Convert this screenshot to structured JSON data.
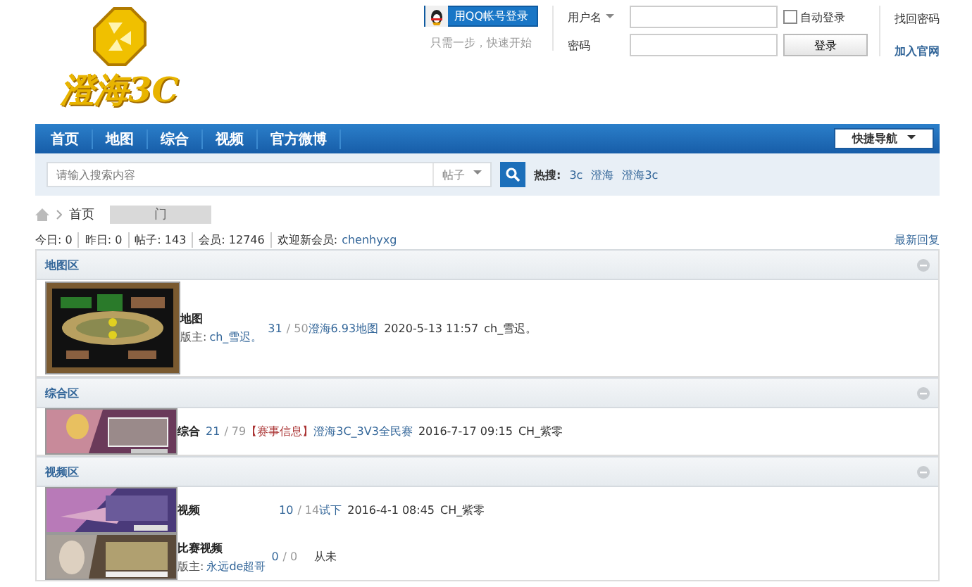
{
  "logo": {
    "text": "澄海3C"
  },
  "login": {
    "qq_button": "用QQ帐号登录",
    "qq_hint": "只需一步，快速开始",
    "username_label": "用户名",
    "password_label": "密码",
    "remember": {
      "label": "自动登录",
      "checked": false
    },
    "submit": "登录",
    "forgot": "找回密码",
    "register": "加入官网"
  },
  "nav": {
    "items": [
      {
        "label": "首页",
        "selected": false
      },
      {
        "label": "地图",
        "selected": false
      },
      {
        "label": "综合",
        "selected": false
      },
      {
        "label": "视频",
        "selected": false
      },
      {
        "label": "官方微博",
        "selected": false
      }
    ],
    "quick": "快捷导航"
  },
  "search": {
    "placeholder": "请输入搜索内容",
    "type": "帖子",
    "hot_label": "热搜:",
    "hot": [
      "3c",
      "澄海",
      "澄海3c"
    ]
  },
  "breadcrumb": {
    "home": "首页",
    "current": "门"
  },
  "stats": {
    "items": [
      "今日: 0",
      "昨日: 0",
      "帖子: 143",
      "会员: 12746"
    ],
    "welcome": "欢迎新会员:",
    "new_member": "chenhyxg",
    "latest": "最新回复"
  },
  "sections": [
    {
      "title": "地图区",
      "forums": [
        {
          "name": "地图",
          "moderator_label": "版主:",
          "moderator": "ch_雪迟。",
          "topics": "31",
          "posts": "/ 50",
          "last_title": "澄海6.93地图",
          "last_time": "2020-5-13 11:57",
          "last_user": "ch_雪迟。"
        }
      ]
    },
    {
      "title": "综合区",
      "forums": [
        {
          "name": "综合",
          "topics": "21",
          "posts": "/ 79",
          "last_tag": "【赛事信息】",
          "last_title": "澄海3C_3V3全民赛",
          "last_time": "2016-7-17 09:15",
          "last_user": "CH_紫零"
        }
      ]
    },
    {
      "title": "视频区",
      "forums": [
        {
          "name": "视频",
          "topics": "10",
          "posts": "/ 14",
          "last_title": "试下",
          "last_time": "2016-4-1 08:45",
          "last_user": "CH_紫零"
        },
        {
          "name": "比赛视频",
          "moderator_label": "版主:",
          "moderator": "永远de超哥",
          "topics": "0",
          "posts": "/ 0",
          "last_none": "从未"
        }
      ]
    }
  ]
}
